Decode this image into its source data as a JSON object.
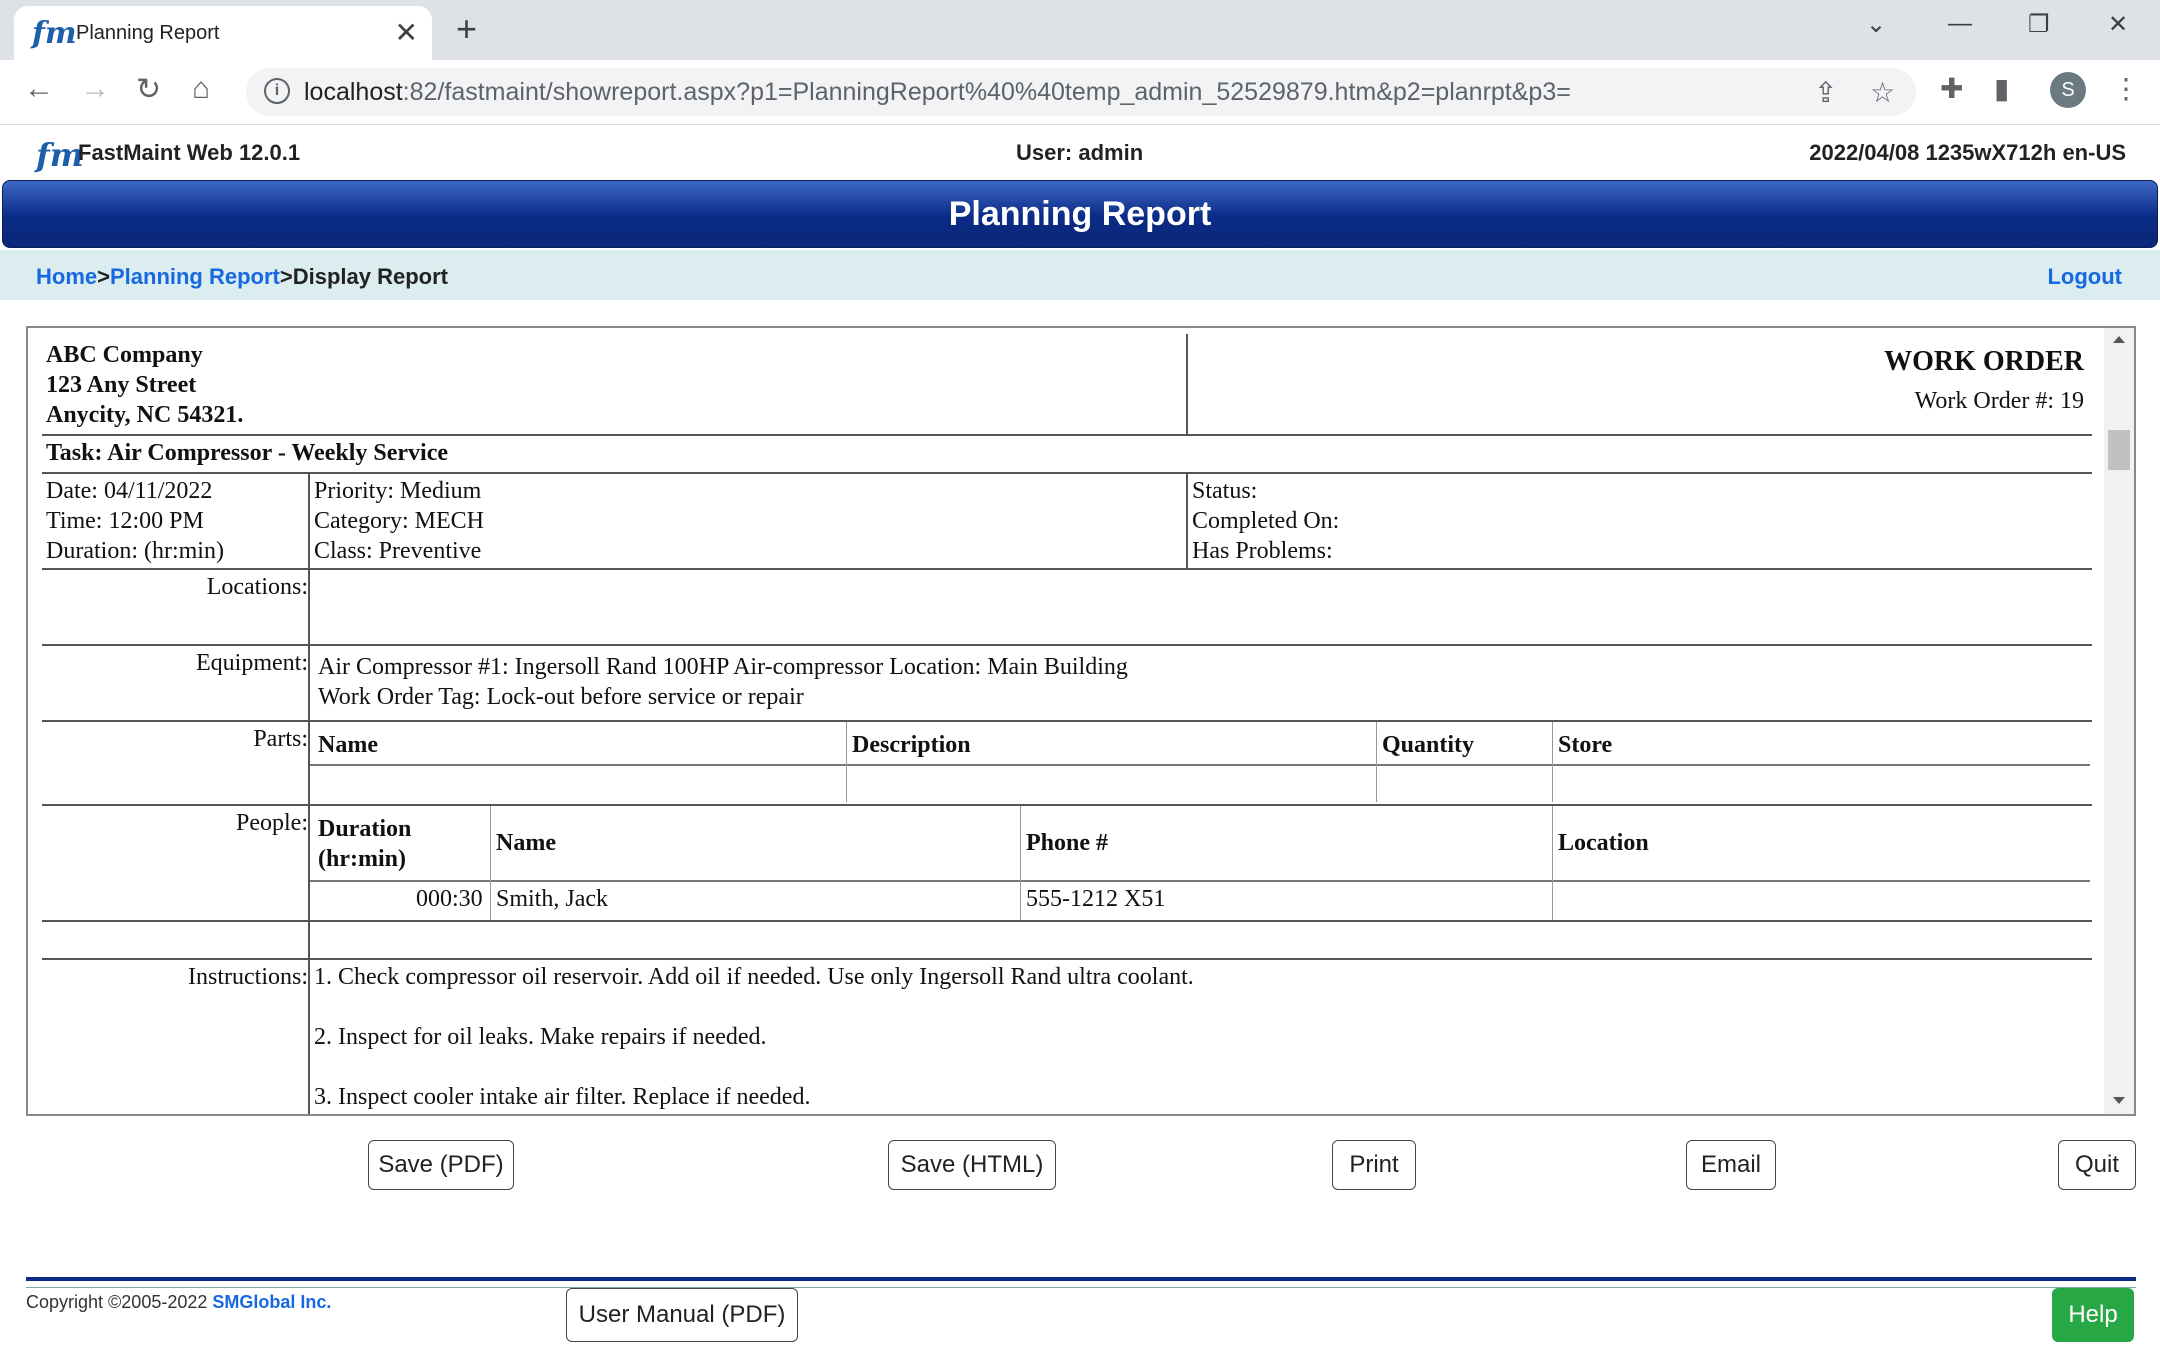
{
  "browser": {
    "tab_title": "Planning Report",
    "url_host": "localhost",
    "url_rest": ":82/fastmaint/showreport.aspx?p1=PlanningReport%40%40temp_admin_52529879.htm&p2=planrpt&p3=",
    "avatar_letter": "S"
  },
  "app": {
    "logo_text": "fm",
    "name": "FastMaint Web 12.0.1",
    "user": "User: admin",
    "session": "2022/04/08 1235wX712h en-US",
    "page_title": "Planning Report"
  },
  "breadcrumb": {
    "home": "Home",
    "sep": ">",
    "planning": "Planning Report",
    "current": "Display Report",
    "logout": "Logout"
  },
  "report": {
    "company": [
      "ABC Company",
      "123 Any Street",
      "Anycity, NC 54321."
    ],
    "doc_title": "WORK ORDER",
    "wo_number": "Work Order #: 19",
    "task": "Task: Air Compressor - Weekly Service",
    "date": "Date: 04/11/2022",
    "time": "Time: 12:00 PM",
    "duration": "Duration: (hr:min)",
    "priority": "Priority: Medium",
    "category": "Category: MECH",
    "class": "Class: Preventive",
    "status": "Status:",
    "completed_on": "Completed On:",
    "has_problems": "Has Problems:",
    "locations_label": "Locations:",
    "equipment_label": "Equipment:",
    "equipment_line1": "Air Compressor #1: Ingersoll Rand 100HP Air-compressor Location: Main Building",
    "equipment_line2": "Work Order Tag: Lock-out before service or repair",
    "parts_label": "Parts:",
    "parts_headers": [
      "Name",
      "Description",
      "Quantity",
      "Store"
    ],
    "people_label": "People:",
    "people_headers": [
      "Duration",
      "(hr:min)",
      "Name",
      "Phone #",
      "Location"
    ],
    "people_row": {
      "duration": "000:30",
      "name": "Smith, Jack",
      "phone": "555-1212 X51",
      "location": ""
    },
    "instructions_label": "Instructions:",
    "instructions": [
      "1. Check compressor oil reservoir. Add oil if needed. Use only Ingersoll Rand ultra coolant.",
      "2. Inspect for oil leaks. Make repairs if needed.",
      "3. Inspect cooler intake air filter. Replace if needed."
    ]
  },
  "buttons": {
    "save_pdf": "Save (PDF)",
    "save_html": "Save (HTML)",
    "print": "Print",
    "email": "Email",
    "quit": "Quit",
    "user_manual": "User Manual (PDF)",
    "help": "Help"
  },
  "footer": {
    "copyright": "Copyright ©2005-2022 ",
    "company_link": "SMGlobal Inc."
  },
  "colors": {
    "title_bar": "#0a2b86",
    "link": "#1668e3",
    "crumb_bg": "#dcedf0",
    "help_btn": "#28a745"
  }
}
